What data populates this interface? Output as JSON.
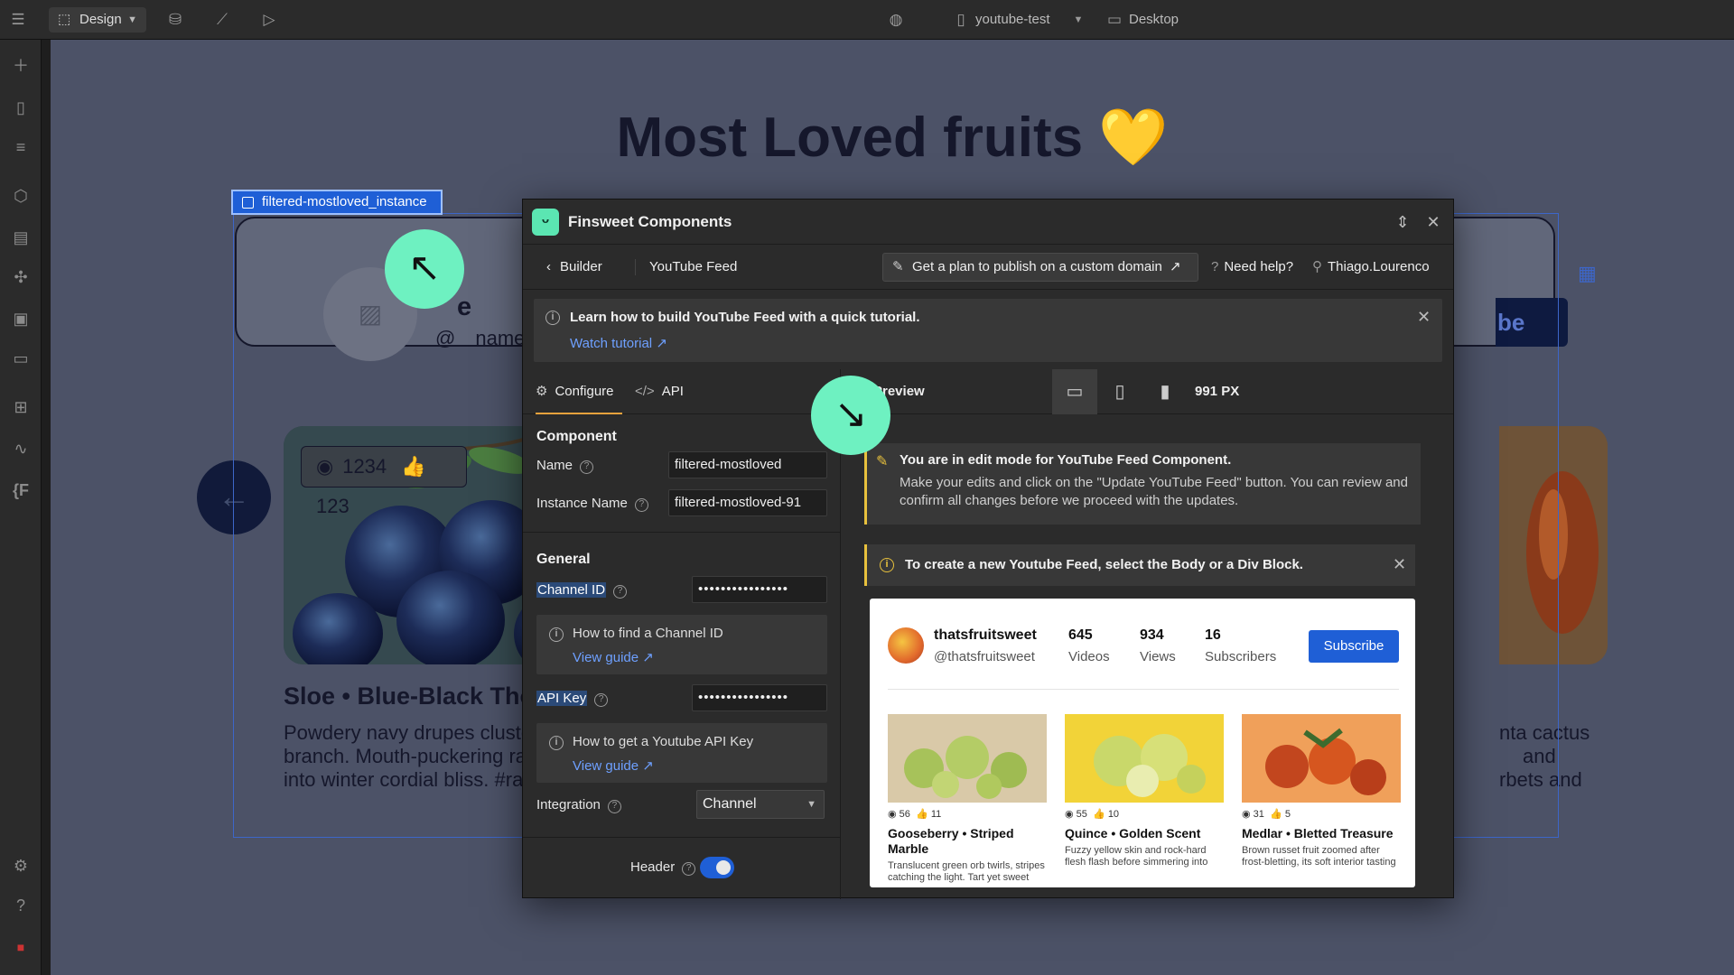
{
  "topbar": {
    "mode_label": "Design",
    "site_name": "youtube-test",
    "breakpoint": "Desktop"
  },
  "canvas": {
    "heading": "Most Loved fruits",
    "heading_emoji": "💛",
    "selection_tag": "filtered-mostloved_instance",
    "header_name_fragment": "e",
    "header_handle_fragment": "@",
    "header_handle_fragment2": "name",
    "subscribe_fragment": "be",
    "card1": {
      "views": "1234",
      "likes": "123",
      "title": "Sloe • Blue-Black Thorn",
      "desc_lines": [
        "Powdery navy drupes cluster o",
        "branch. Mouth-puckering raw,",
        "into winter cordial bliss. #raref"
      ]
    },
    "card3_desc_lines": [
      "nta cactus",
      "and",
      "rbets and"
    ]
  },
  "panel": {
    "title": "Finsweet Components",
    "back_label": "Builder",
    "breadcrumb": "YouTube Feed",
    "plan_button": "Get a plan to publish on a custom domain",
    "help_label": "Need help?",
    "user": "Thiago.Lourenco",
    "tutorial": {
      "text": "Learn how to build YouTube Feed with a quick tutorial.",
      "link": "Watch tutorial"
    },
    "tabs": {
      "configure": "Configure",
      "api": "API",
      "preview": "Preview"
    },
    "viewport_width": "991 PX",
    "component": {
      "section": "Component",
      "name_label": "Name",
      "name_value": "filtered-mostloved",
      "instance_label": "Instance Name",
      "instance_value": "filtered-mostloved-91"
    },
    "general": {
      "section": "General",
      "channel_label": "Channel ID",
      "channel_value": "••••••••••••••••",
      "channel_help": "How to find a Channel ID",
      "channel_help_link": "View guide",
      "api_label": "API Key",
      "api_value": "••••••••••••••••",
      "api_help": "How to get a Youtube API Key",
      "api_help_link": "View guide",
      "integration_label": "Integration",
      "integration_value": "Channel",
      "header_label": "Header"
    },
    "edit_notice": {
      "title": "You are in edit mode for YouTube Feed Component.",
      "body": "Make your edits and click on the \"Update YouTube Feed\" button. You can review and confirm all changes before we proceed with the updates."
    },
    "create_notice": "To create a new Youtube Feed, select the Body or a Div Block.",
    "preview_feed": {
      "channel_name": "thatsfruitsweet",
      "handle": "@thatsfruitsweet",
      "stats": [
        {
          "value": "645",
          "label": "Videos"
        },
        {
          "value": "934",
          "label": "Views"
        },
        {
          "value": "16",
          "label": "Subscribers"
        }
      ],
      "subscribe": "Subscribe",
      "videos": [
        {
          "views": "56",
          "likes": "11",
          "title": "Gooseberry • Striped Marble",
          "desc": "Translucent green orb twirls, stripes catching the light. Tart yet sweet"
        },
        {
          "views": "55",
          "likes": "10",
          "title": "Quince • Golden Scent",
          "desc": "Fuzzy yellow skin and rock-hard flesh flash before simmering into"
        },
        {
          "views": "31",
          "likes": "5",
          "title": "Medlar • Bletted Treasure",
          "desc": "Brown russet fruit zoomed after frost-bletting, its soft interior tasting"
        }
      ]
    }
  }
}
